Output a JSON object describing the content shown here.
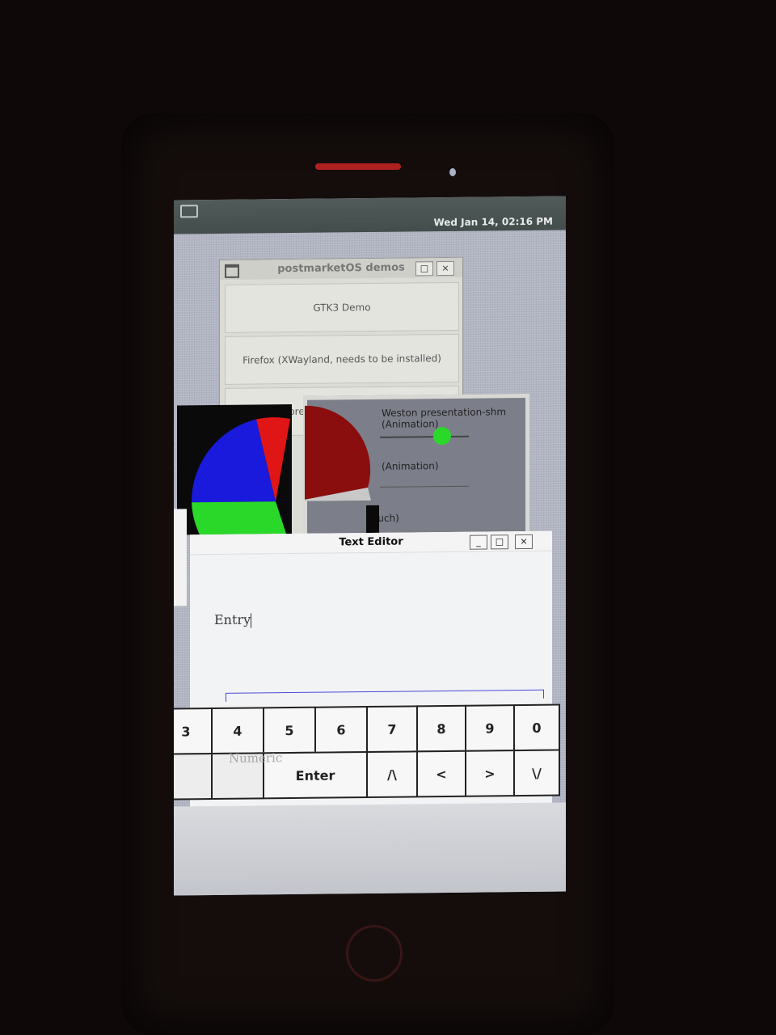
{
  "status_bar": {
    "clock": "Wed Jan 14, 02:16 PM"
  },
  "demos_window": {
    "title": "postmarketOS demos",
    "items": [
      "GTK3 Demo",
      "Firefox (XWayland, needs to be installed)",
      "Weston presentation-shm (Animation)",
      "(Animation)",
      "ouch)"
    ],
    "maximize_glyph": "□",
    "close_glyph": "×"
  },
  "animation_window": {
    "knob_color": "#2ad82a"
  },
  "pie_chart": {
    "slices": [
      {
        "color": "#1a1adc"
      },
      {
        "color": "#e01616"
      },
      {
        "color": "#2ad82a"
      },
      {
        "color": "#8a0e0e"
      },
      {
        "color": "#c8c8c8"
      }
    ]
  },
  "text_editor": {
    "title": "Text Editor",
    "minimize_glyph": "_",
    "maximize_glyph": "□",
    "close_glyph": "×",
    "entry_value": "Entry",
    "numeric_placeholder": "Numeric"
  },
  "keyboard": {
    "row1": [
      "3",
      "4",
      "5",
      "6",
      "7",
      "8",
      "9",
      "0"
    ],
    "row2": [
      "",
      "",
      "Enter",
      "/\\",
      "<",
      ">",
      "\\/"
    ]
  }
}
